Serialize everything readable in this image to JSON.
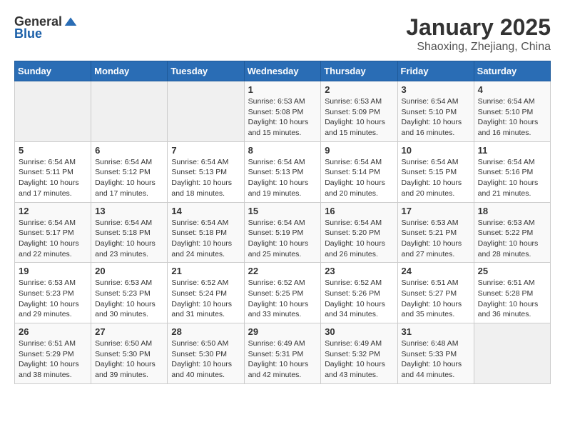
{
  "header": {
    "logo_general": "General",
    "logo_blue": "Blue",
    "month_title": "January 2025",
    "subtitle": "Shaoxing, Zhejiang, China"
  },
  "weekdays": [
    "Sunday",
    "Monday",
    "Tuesday",
    "Wednesday",
    "Thursday",
    "Friday",
    "Saturday"
  ],
  "weeks": [
    [
      {
        "day": "",
        "info": ""
      },
      {
        "day": "",
        "info": ""
      },
      {
        "day": "",
        "info": ""
      },
      {
        "day": "1",
        "info": "Sunrise: 6:53 AM\nSunset: 5:08 PM\nDaylight: 10 hours\nand 15 minutes."
      },
      {
        "day": "2",
        "info": "Sunrise: 6:53 AM\nSunset: 5:09 PM\nDaylight: 10 hours\nand 15 minutes."
      },
      {
        "day": "3",
        "info": "Sunrise: 6:54 AM\nSunset: 5:10 PM\nDaylight: 10 hours\nand 16 minutes."
      },
      {
        "day": "4",
        "info": "Sunrise: 6:54 AM\nSunset: 5:10 PM\nDaylight: 10 hours\nand 16 minutes."
      }
    ],
    [
      {
        "day": "5",
        "info": "Sunrise: 6:54 AM\nSunset: 5:11 PM\nDaylight: 10 hours\nand 17 minutes."
      },
      {
        "day": "6",
        "info": "Sunrise: 6:54 AM\nSunset: 5:12 PM\nDaylight: 10 hours\nand 17 minutes."
      },
      {
        "day": "7",
        "info": "Sunrise: 6:54 AM\nSunset: 5:13 PM\nDaylight: 10 hours\nand 18 minutes."
      },
      {
        "day": "8",
        "info": "Sunrise: 6:54 AM\nSunset: 5:13 PM\nDaylight: 10 hours\nand 19 minutes."
      },
      {
        "day": "9",
        "info": "Sunrise: 6:54 AM\nSunset: 5:14 PM\nDaylight: 10 hours\nand 20 minutes."
      },
      {
        "day": "10",
        "info": "Sunrise: 6:54 AM\nSunset: 5:15 PM\nDaylight: 10 hours\nand 20 minutes."
      },
      {
        "day": "11",
        "info": "Sunrise: 6:54 AM\nSunset: 5:16 PM\nDaylight: 10 hours\nand 21 minutes."
      }
    ],
    [
      {
        "day": "12",
        "info": "Sunrise: 6:54 AM\nSunset: 5:17 PM\nDaylight: 10 hours\nand 22 minutes."
      },
      {
        "day": "13",
        "info": "Sunrise: 6:54 AM\nSunset: 5:18 PM\nDaylight: 10 hours\nand 23 minutes."
      },
      {
        "day": "14",
        "info": "Sunrise: 6:54 AM\nSunset: 5:18 PM\nDaylight: 10 hours\nand 24 minutes."
      },
      {
        "day": "15",
        "info": "Sunrise: 6:54 AM\nSunset: 5:19 PM\nDaylight: 10 hours\nand 25 minutes."
      },
      {
        "day": "16",
        "info": "Sunrise: 6:54 AM\nSunset: 5:20 PM\nDaylight: 10 hours\nand 26 minutes."
      },
      {
        "day": "17",
        "info": "Sunrise: 6:53 AM\nSunset: 5:21 PM\nDaylight: 10 hours\nand 27 minutes."
      },
      {
        "day": "18",
        "info": "Sunrise: 6:53 AM\nSunset: 5:22 PM\nDaylight: 10 hours\nand 28 minutes."
      }
    ],
    [
      {
        "day": "19",
        "info": "Sunrise: 6:53 AM\nSunset: 5:23 PM\nDaylight: 10 hours\nand 29 minutes."
      },
      {
        "day": "20",
        "info": "Sunrise: 6:53 AM\nSunset: 5:23 PM\nDaylight: 10 hours\nand 30 minutes."
      },
      {
        "day": "21",
        "info": "Sunrise: 6:52 AM\nSunset: 5:24 PM\nDaylight: 10 hours\nand 31 minutes."
      },
      {
        "day": "22",
        "info": "Sunrise: 6:52 AM\nSunset: 5:25 PM\nDaylight: 10 hours\nand 33 minutes."
      },
      {
        "day": "23",
        "info": "Sunrise: 6:52 AM\nSunset: 5:26 PM\nDaylight: 10 hours\nand 34 minutes."
      },
      {
        "day": "24",
        "info": "Sunrise: 6:51 AM\nSunset: 5:27 PM\nDaylight: 10 hours\nand 35 minutes."
      },
      {
        "day": "25",
        "info": "Sunrise: 6:51 AM\nSunset: 5:28 PM\nDaylight: 10 hours\nand 36 minutes."
      }
    ],
    [
      {
        "day": "26",
        "info": "Sunrise: 6:51 AM\nSunset: 5:29 PM\nDaylight: 10 hours\nand 38 minutes."
      },
      {
        "day": "27",
        "info": "Sunrise: 6:50 AM\nSunset: 5:30 PM\nDaylight: 10 hours\nand 39 minutes."
      },
      {
        "day": "28",
        "info": "Sunrise: 6:50 AM\nSunset: 5:30 PM\nDaylight: 10 hours\nand 40 minutes."
      },
      {
        "day": "29",
        "info": "Sunrise: 6:49 AM\nSunset: 5:31 PM\nDaylight: 10 hours\nand 42 minutes."
      },
      {
        "day": "30",
        "info": "Sunrise: 6:49 AM\nSunset: 5:32 PM\nDaylight: 10 hours\nand 43 minutes."
      },
      {
        "day": "31",
        "info": "Sunrise: 6:48 AM\nSunset: 5:33 PM\nDaylight: 10 hours\nand 44 minutes."
      },
      {
        "day": "",
        "info": ""
      }
    ]
  ]
}
